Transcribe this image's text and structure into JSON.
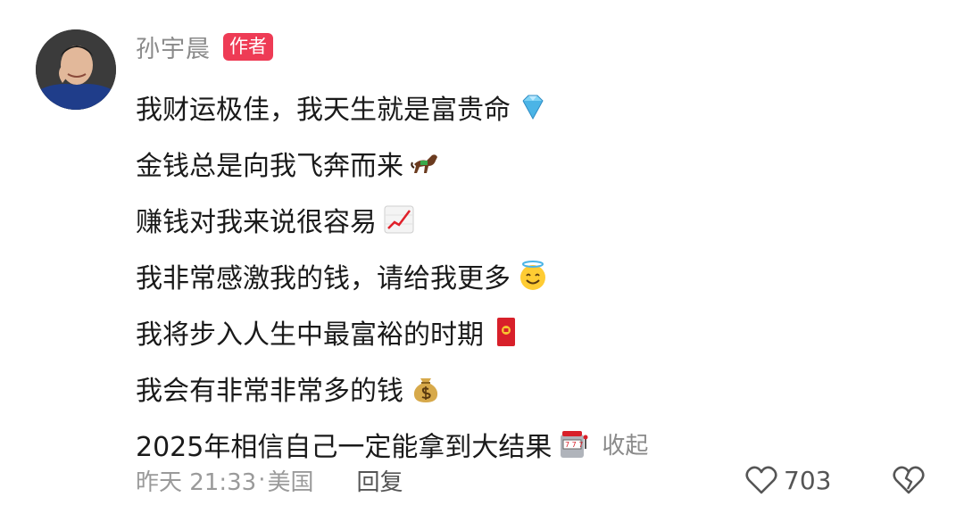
{
  "author": {
    "name": "孙宇晨",
    "badge": "作者"
  },
  "comment": {
    "lines": [
      {
        "text": "我财运极佳，我天生就是富贵命",
        "emoji": "gem-icon"
      },
      {
        "text": "金钱总是向我飞奔而来",
        "emoji": "racehorse-icon"
      },
      {
        "text": "赚钱对我来说很容易",
        "emoji": "chart-increasing-icon"
      },
      {
        "text": "我非常感激我的钱，请给我更多",
        "emoji": "smiling-face-with-halo-icon"
      },
      {
        "text": "我将步入人生中最富裕的时期",
        "emoji": "red-envelope-icon"
      },
      {
        "text": "我会有非常非常多的钱",
        "emoji": "money-bag-icon"
      },
      {
        "text": "2025年相信自己一定能拿到大结果",
        "emoji": "slot-machine-icon"
      }
    ],
    "collapse_label": "收起"
  },
  "footer": {
    "timestamp": "昨天 21:33",
    "separator": "·",
    "location": "美国",
    "reply_label": "回复",
    "like_count": "703"
  },
  "colors": {
    "badge": "#ee3b55",
    "muted_text": "#8a8a8a",
    "body_text": "#1a1a1a"
  }
}
